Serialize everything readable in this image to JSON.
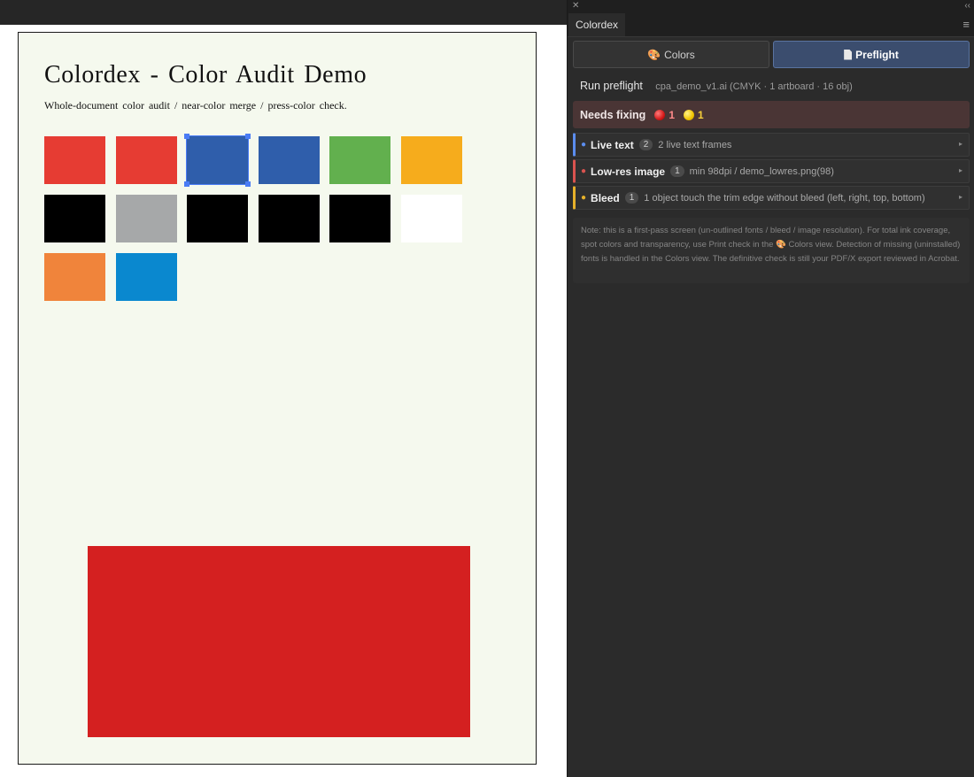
{
  "document": {
    "title": "Colordex - Color Audit Demo",
    "subtitle": "Whole-document color audit / near-color merge / press-color check.",
    "swatches": [
      {
        "color": "#e63c33"
      },
      {
        "color": "#e63c33"
      },
      {
        "color": "#2f5eab",
        "selected": true
      },
      {
        "color": "#2f5eab"
      },
      {
        "color": "#62b04e"
      },
      {
        "color": "#f6ac1c"
      },
      {
        "color": "#000000"
      },
      {
        "color": "#a6a8a9"
      },
      {
        "color": "#000000"
      },
      {
        "color": "#000000"
      },
      {
        "color": "#000000"
      },
      {
        "color": "#ffffff"
      },
      {
        "color": "#f0843b"
      },
      {
        "color": "#0a88cf"
      }
    ],
    "big_rect_color": "#d42020"
  },
  "panel": {
    "close_icon": "✕",
    "collapse_icon": "‹‹",
    "tab_label": "Colordex",
    "menu_icon": "≡",
    "view_tabs": {
      "colors_icon": "🎨",
      "colors_label": "Colors",
      "preflight_label": "Preflight",
      "active": "preflight"
    },
    "run": {
      "label": "Run preflight",
      "meta": "cpa_demo_v1.ai (CMYK · 1 artboard · 16 obj)"
    },
    "needs_fixing": {
      "label": "Needs fixing",
      "red_count": "1",
      "yellow_count": "1",
      "color": "#4a3535"
    },
    "issues": [
      {
        "title": "Live text",
        "count": "2",
        "desc": "2 live text frames",
        "accent": "#5b8def"
      },
      {
        "title": "Low-res image",
        "count": "1",
        "desc": "min 98dpi / demo_lowres.png(98)",
        "accent": "#d9534f"
      },
      {
        "title": "Bleed",
        "count": "1",
        "desc": "1 object touch the trim edge without bleed (left, right, top, bottom)",
        "accent": "#e6b12a"
      }
    ],
    "note": "Note: this is a first-pass screen (un-outlined fonts / bleed / image resolution). For total ink coverage, spot colors and transparency, use Print check in the 🎨 Colors view. Detection of missing (uninstalled) fonts is handled in the Colors view. The definitive check is still your PDF/X export reviewed in Acrobat."
  }
}
